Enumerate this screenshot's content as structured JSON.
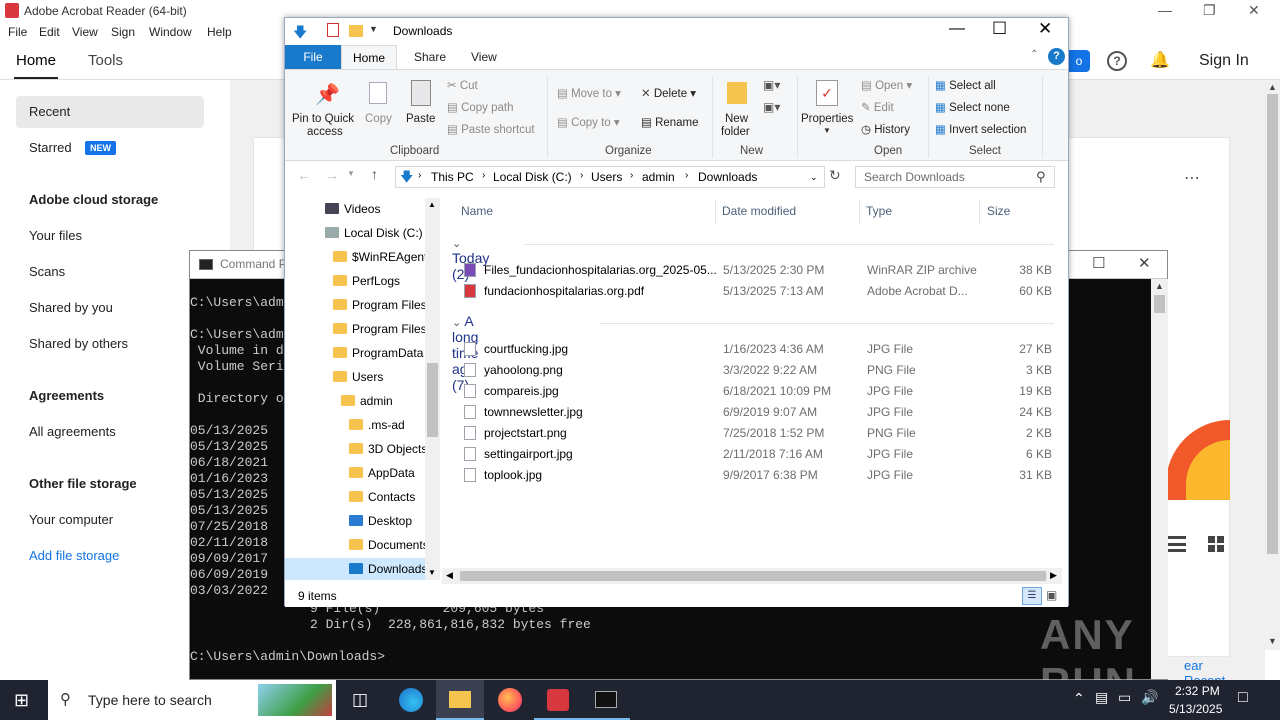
{
  "acrobat": {
    "title": "Adobe Acrobat Reader (64-bit)",
    "menu": [
      "File",
      "Edit",
      "View",
      "Sign",
      "Window",
      "Help"
    ],
    "tabs": {
      "home": "Home",
      "tools": "Tools"
    },
    "sign_in": "Sign In",
    "sidebar": {
      "recent": "Recent",
      "starred": "Starred",
      "new_badge": "NEW",
      "cloud_heading": "Adobe cloud storage",
      "your_files": "Your files",
      "scans": "Scans",
      "shared_by_you": "Shared by you",
      "shared_by_others": "Shared by others",
      "agreements_heading": "Agreements",
      "all_agreements": "All agreements",
      "other_heading": "Other file storage",
      "your_computer": "Your computer",
      "add_storage": "Add file storage"
    },
    "clear_recent": "ear Recent",
    "accent": "#d7373f"
  },
  "cmd": {
    "title": "Command P",
    "lines_left": [
      "C:\\Users\\adm",
      "",
      "C:\\Users\\adm",
      " Volume in d",
      " Volume Seri",
      "",
      " Directory o",
      "",
      "05/13/2025",
      "05/13/2025",
      "06/18/2021",
      "01/16/2023",
      "05/13/2025",
      "05/13/2025",
      "07/25/2018",
      "02/11/2018",
      "09/09/2017",
      "06/09/2019",
      "03/03/2022"
    ],
    "summary_files": "9 File(s)        209,605 bytes",
    "summary_dirs": "2 Dir(s)  228,861,816,832 bytes free",
    "prompt": "C:\\Users\\admin\\Downloads>"
  },
  "explorer": {
    "title": "Downloads",
    "tabs": {
      "file": "File",
      "home": "Home",
      "share": "Share",
      "view": "View"
    },
    "ribbon": {
      "pin": "Pin to Quick access",
      "pin_l1": "Pin to Quick",
      "pin_l2": "access",
      "copy": "Copy",
      "paste": "Paste",
      "cut": "Cut",
      "copy_path": "Copy path",
      "paste_shortcut": "Paste shortcut",
      "clipboard": "Clipboard",
      "move_to": "Move to",
      "copy_to": "Copy to",
      "delete": "Delete",
      "rename": "Rename",
      "organize": "Organize",
      "new_folder_l1": "New",
      "new_folder_l2": "folder",
      "new": "New",
      "properties": "Properties",
      "open": "Open",
      "edit": "Edit",
      "history": "History",
      "open_group": "Open",
      "select_all": "Select all",
      "select_none": "Select none",
      "invert_selection": "Invert selection",
      "select": "Select"
    },
    "breadcrumb": [
      "This PC",
      "Local Disk (C:)",
      "Users",
      "admin",
      "Downloads"
    ],
    "search_placeholder": "Search Downloads",
    "nav": [
      {
        "label": "Videos",
        "indent": 0
      },
      {
        "label": "Local Disk (C:)",
        "indent": 0
      },
      {
        "label": "$WinREAgent",
        "indent": 1
      },
      {
        "label": "PerfLogs",
        "indent": 1
      },
      {
        "label": "Program Files",
        "indent": 1
      },
      {
        "label": "Program Files",
        "indent": 1
      },
      {
        "label": "ProgramData",
        "indent": 1
      },
      {
        "label": "Users",
        "indent": 1
      },
      {
        "label": "admin",
        "indent": 2
      },
      {
        "label": ".ms-ad",
        "indent": 3
      },
      {
        "label": "3D Objects",
        "indent": 3
      },
      {
        "label": "AppData",
        "indent": 3
      },
      {
        "label": "Contacts",
        "indent": 3
      },
      {
        "label": "Desktop",
        "indent": 3
      },
      {
        "label": "Documents",
        "indent": 3
      },
      {
        "label": "Downloads",
        "indent": 3
      }
    ],
    "columns": {
      "name": "Name",
      "date": "Date modified",
      "type": "Type",
      "size": "Size"
    },
    "groups": [
      {
        "label": "Today (2)",
        "files": [
          {
            "name": "Files_fundacionhospitalarias.org_2025-05...",
            "date": "5/13/2025 2:30 PM",
            "type": "WinRAR ZIP archive",
            "size": "38 KB",
            "icon": "zip-icon"
          },
          {
            "name": "fundacionhospitalarias.org.pdf",
            "date": "5/13/2025 7:13 AM",
            "type": "Adobe Acrobat D...",
            "size": "60 KB",
            "icon": "pdf-icon"
          }
        ]
      },
      {
        "label": "A long time ago (7)",
        "files": [
          {
            "name": "courtfucking.jpg",
            "date": "1/16/2023 4:36 AM",
            "type": "JPG File",
            "size": "27 KB",
            "icon": "image-icon"
          },
          {
            "name": "yahoolong.png",
            "date": "3/3/2022 9:22 AM",
            "type": "PNG File",
            "size": "3 KB",
            "icon": "image-icon"
          },
          {
            "name": "compareis.jpg",
            "date": "6/18/2021 10:09 PM",
            "type": "JPG File",
            "size": "19 KB",
            "icon": "image-icon"
          },
          {
            "name": "townnewsletter.jpg",
            "date": "6/9/2019 9:07 AM",
            "type": "JPG File",
            "size": "24 KB",
            "icon": "image-icon"
          },
          {
            "name": "projectstart.png",
            "date": "7/25/2018 1:52 PM",
            "type": "PNG File",
            "size": "2 KB",
            "icon": "image-icon"
          },
          {
            "name": "settingairport.jpg",
            "date": "2/11/2018 7:16 AM",
            "type": "JPG File",
            "size": "6 KB",
            "icon": "image-icon"
          },
          {
            "name": "toplook.jpg",
            "date": "9/9/2017 6:38 PM",
            "type": "JPG File",
            "size": "31 KB",
            "icon": "image-icon"
          }
        ]
      }
    ],
    "status": "9 items",
    "accent": "#1979ca"
  },
  "taskbar": {
    "search_placeholder": "Type here to search",
    "time": "2:32 PM",
    "date": "5/13/2025"
  },
  "watermark": "ANY RUN"
}
